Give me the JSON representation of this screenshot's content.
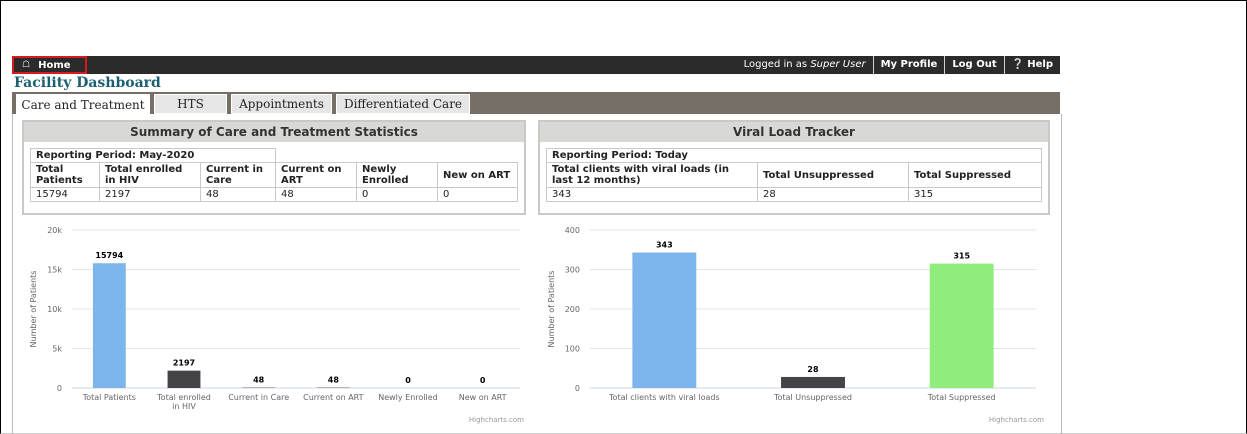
{
  "nav": {
    "home_label": "Home",
    "logged_in_prefix": "Logged in as",
    "user_name": "Super User",
    "my_profile": "My Profile",
    "log_out": "Log Out",
    "help": "Help"
  },
  "page_title": "Facility Dashboard",
  "tabs": [
    {
      "label": "Care and Treatment",
      "active": true
    },
    {
      "label": "HTS",
      "active": false
    },
    {
      "label": "Appointments",
      "active": false
    },
    {
      "label": "Differentiated Care",
      "active": false
    }
  ],
  "summary": {
    "heading": "Summary of Care and Treatment Statistics",
    "period_label": "Reporting Period: May-2020",
    "headers": [
      "Total Patients",
      "Total enrolled in HIV",
      "Current in Care",
      "Current on ART",
      "Newly Enrolled",
      "New on ART"
    ],
    "values": [
      "15794",
      "2197",
      "48",
      "48",
      "0",
      "0"
    ]
  },
  "viral": {
    "heading": "Viral Load Tracker",
    "period_label": "Reporting Period: Today",
    "headers": [
      "Total clients with viral loads (in last 12 months)",
      "Total Unsuppressed",
      "Total Suppressed"
    ],
    "values": [
      "343",
      "28",
      "315"
    ]
  },
  "chart_data": [
    {
      "type": "bar",
      "title": "",
      "xlabel": "",
      "ylabel": "Number of Patients",
      "ylim": [
        0,
        20000
      ],
      "yticks": [
        "0",
        "5k",
        "10k",
        "15k",
        "20k"
      ],
      "categories": [
        "Total Patients",
        "Total enrolled in HIV",
        "Current in Care",
        "Current on ART",
        "Newly Enrolled",
        "New on ART"
      ],
      "values": [
        15794,
        2197,
        48,
        48,
        0,
        0
      ],
      "colors": [
        "#7cb5ec",
        "#434348",
        "#434348",
        "#434348",
        "#434348",
        "#434348"
      ],
      "credit": "Highcharts.com",
      "grid": true
    },
    {
      "type": "bar",
      "title": "",
      "xlabel": "",
      "ylabel": "Number of Patients",
      "ylim": [
        0,
        400
      ],
      "yticks": [
        "0",
        "100",
        "200",
        "300",
        "400"
      ],
      "categories": [
        "Total clients with viral loads",
        "Total Unsuppressed",
        "Total Suppressed"
      ],
      "values": [
        343,
        28,
        315
      ],
      "colors": [
        "#7cb5ec",
        "#434348",
        "#90ed7d"
      ],
      "credit": "Highcharts.com",
      "grid": true
    }
  ]
}
